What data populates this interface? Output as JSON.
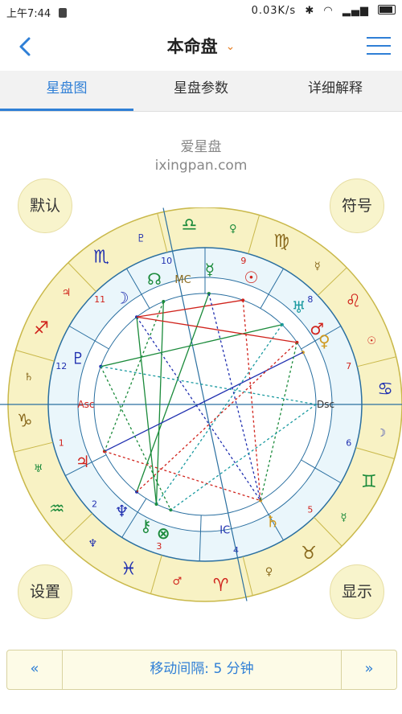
{
  "status": {
    "time": "上午7:44",
    "speed": "0.03K/s"
  },
  "header": {
    "title": "本命盘",
    "chevron": "⌄"
  },
  "tabs": [
    {
      "label": "星盘图"
    },
    {
      "label": "星盘参数"
    },
    {
      "label": "详细解释"
    }
  ],
  "brand": {
    "name": "爱星盘",
    "url": "ixingpan.com"
  },
  "buttons": {
    "default": "默认",
    "symbols": "符号",
    "settings": "设置",
    "display": "显示"
  },
  "chart": {
    "houses": [
      "1",
      "2",
      "3",
      "4",
      "5",
      "6",
      "7",
      "8",
      "9",
      "10",
      "11",
      "12"
    ],
    "angles": {
      "asc": "Asc",
      "dsc": "Dsc",
      "mc": "MC",
      "ic": "IC"
    },
    "signs": [
      "♈",
      "♉",
      "♊",
      "♋",
      "♌",
      "♍",
      "♎",
      "♏",
      "♐",
      "♑",
      "♒",
      "♓"
    ],
    "rulers": [
      "♂",
      "♀",
      "☿",
      "☽",
      "☉",
      "☿",
      "♀",
      "♇",
      "♃",
      "♄",
      "♅",
      "♆"
    ],
    "planets": {
      "sun": "☉",
      "moon": "☽",
      "mercury": "☿",
      "venus": "♀",
      "mars": "♂",
      "jupiter": "♃",
      "saturn": "♄",
      "uranus": "♅",
      "neptune": "♆",
      "pluto": "♇",
      "node": "☊",
      "fortune": "⊗",
      "chiron": "⚷"
    },
    "colors": {
      "fire": "#d0231c",
      "earth": "#8a6a1e",
      "air": "#1a8a3a",
      "water": "#2030b0",
      "ring": "#f8f2c4",
      "inner": "#eaf6fb",
      "line": "#2a6fa0"
    }
  },
  "footer": {
    "prev": "«",
    "next": "»",
    "interval": "移动间隔: 5 分钟"
  }
}
